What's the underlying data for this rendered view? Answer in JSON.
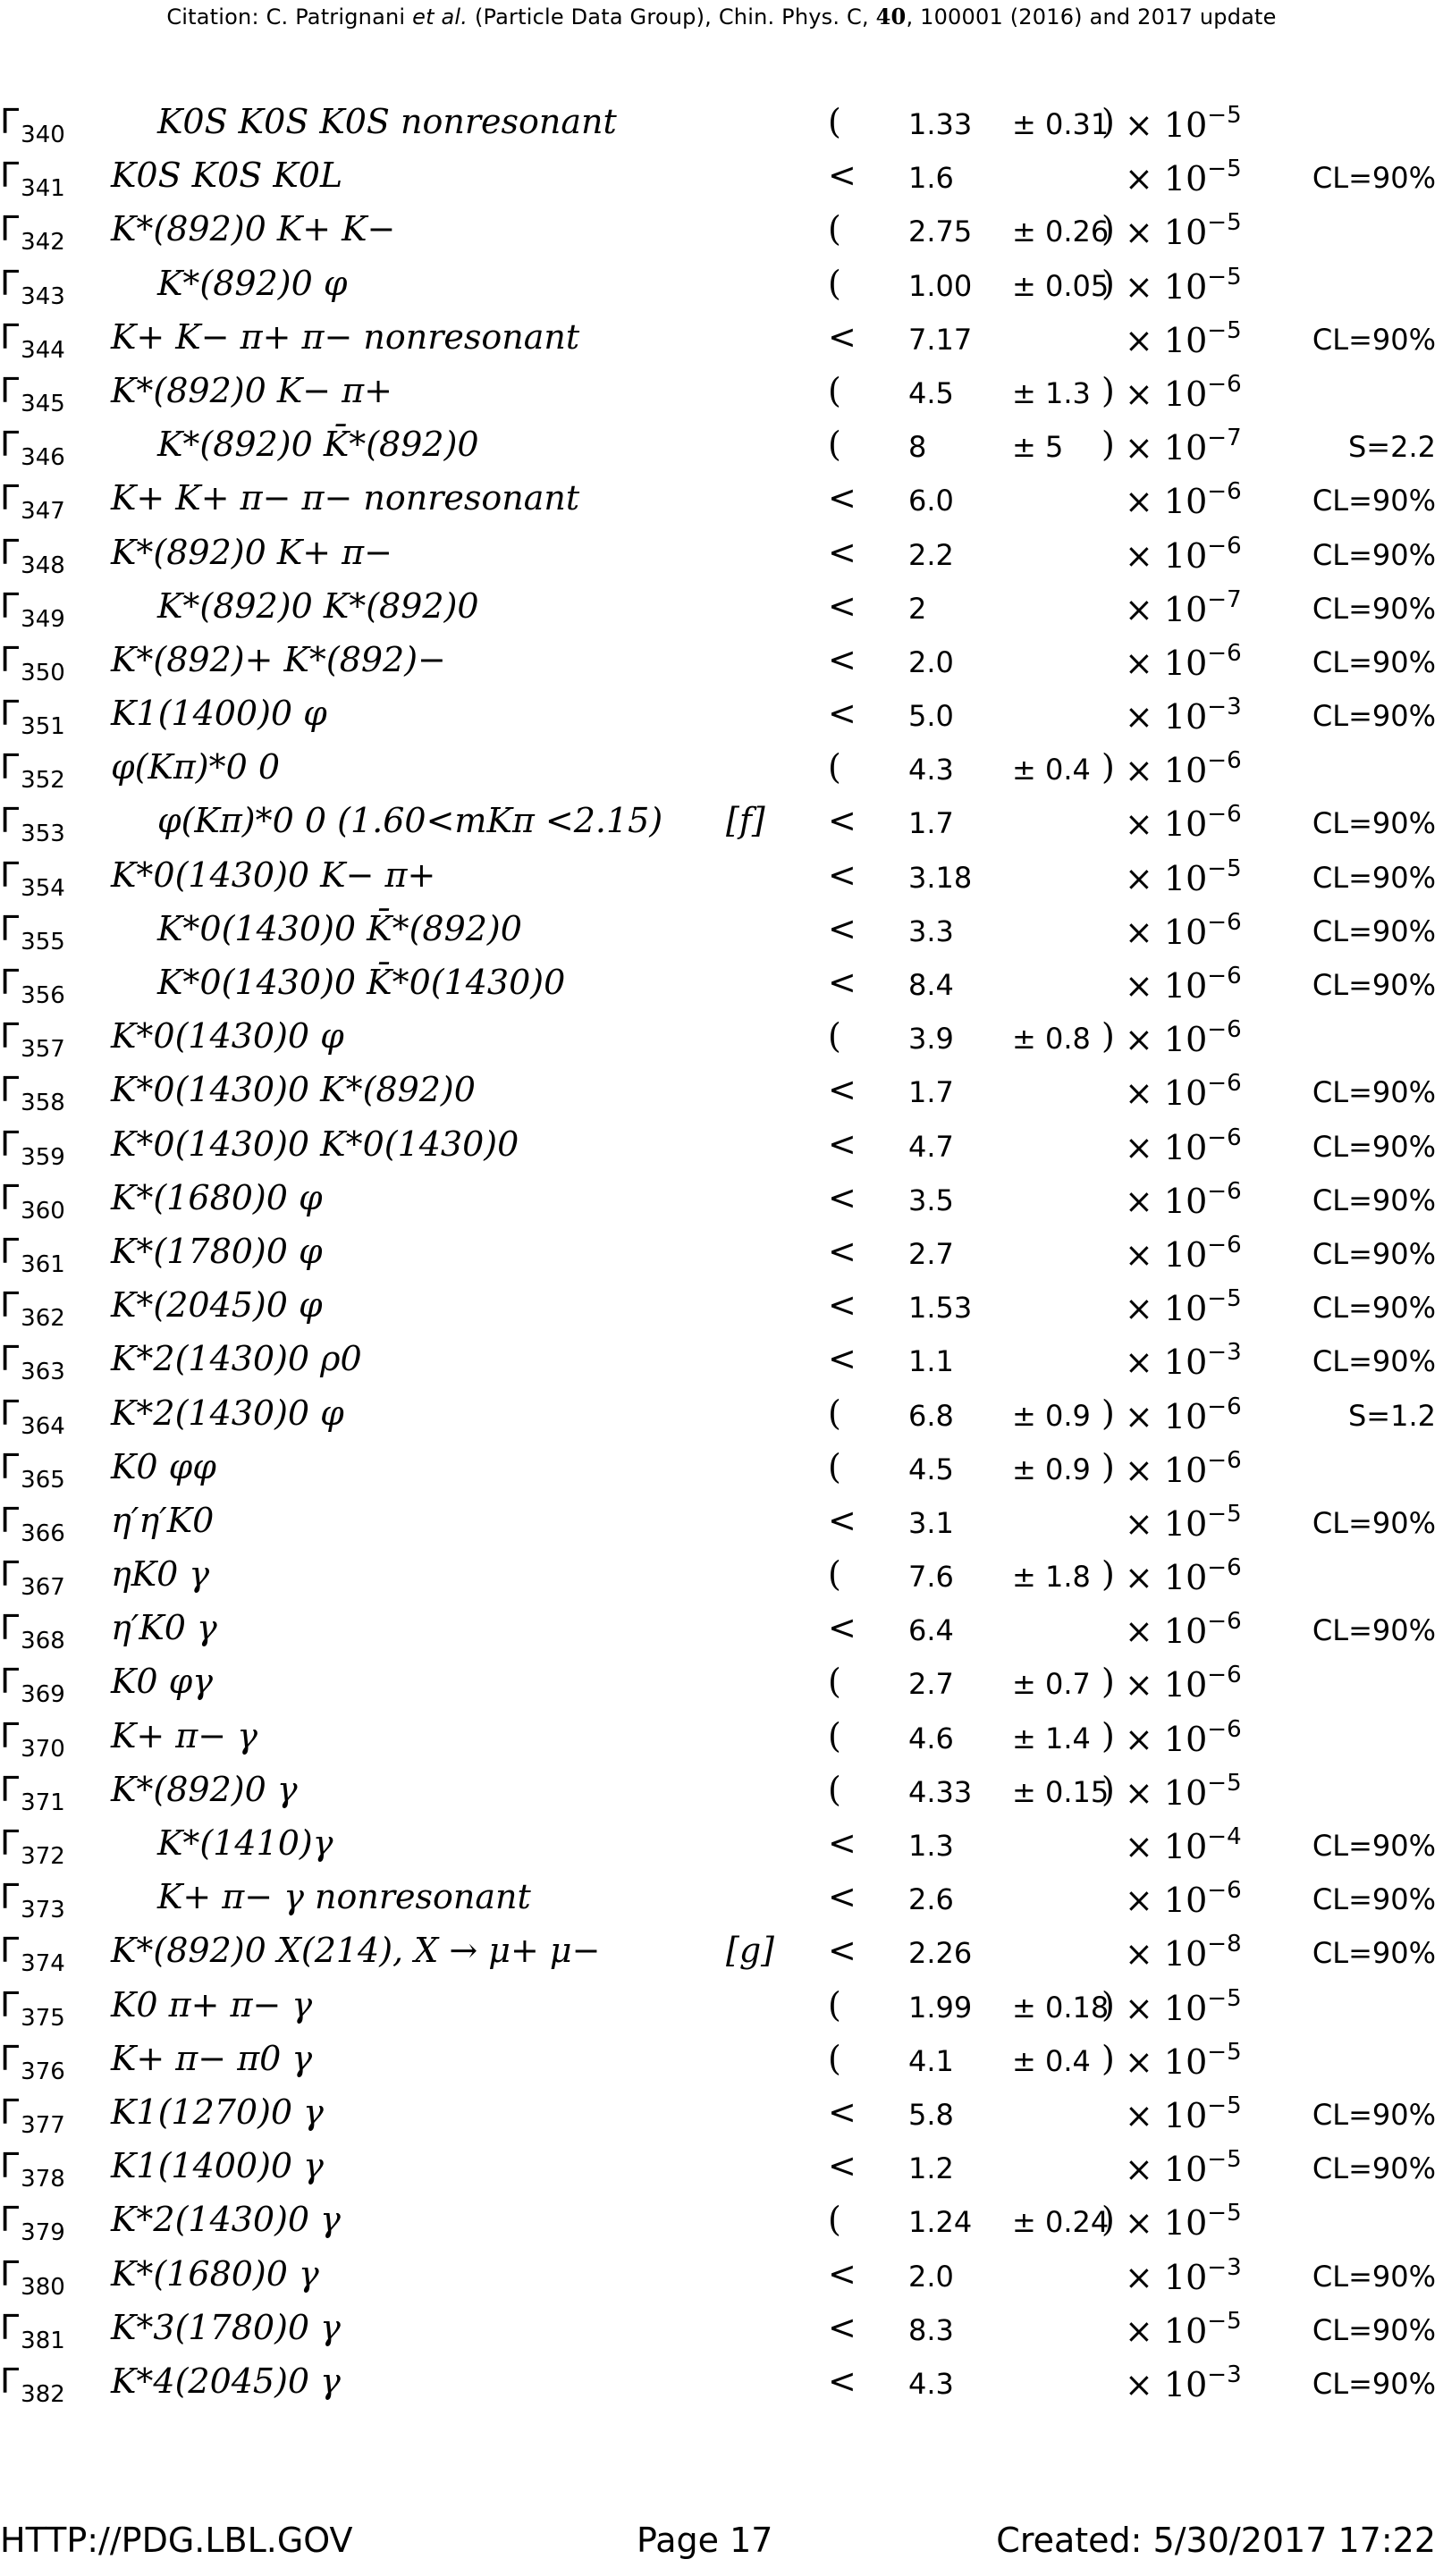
{
  "header": {
    "citation_prefix": "Citation: C. Patrignani ",
    "citation_etal": "et al.",
    "citation_mid": " (Particle Data Group), Chin. Phys. C, ",
    "citation_vol": "40",
    "citation_suffix": ", 100001 (2016) and 2017 update"
  },
  "rows": [
    {
      "gamma": "340",
      "mode": "K0S K0S K0S nonresonant",
      "indent": true,
      "rel": "(",
      "value": "1.33",
      "error": "± 0.31",
      "close": ")",
      "exponent": "−5",
      "extra": ""
    },
    {
      "gamma": "341",
      "mode": "K0S K0S K0L",
      "indent": false,
      "rel": "<",
      "value": "1.6",
      "error": "",
      "close": "",
      "exponent": "−5",
      "extra": "CL=90%"
    },
    {
      "gamma": "342",
      "mode": "K*(892)0 K+ K−",
      "indent": false,
      "rel": "(",
      "value": "2.75",
      "error": "± 0.26",
      "close": ")",
      "exponent": "−5",
      "extra": ""
    },
    {
      "gamma": "343",
      "mode": "K*(892)0 φ",
      "indent": true,
      "rel": "(",
      "value": "1.00",
      "error": "± 0.05",
      "close": ")",
      "exponent": "−5",
      "extra": ""
    },
    {
      "gamma": "344",
      "mode": "K+ K− π+ π− nonresonant",
      "indent": false,
      "rel": "<",
      "value": "7.17",
      "error": "",
      "close": "",
      "exponent": "−5",
      "extra": "CL=90%"
    },
    {
      "gamma": "345",
      "mode": "K*(892)0 K− π+",
      "indent": false,
      "rel": "(",
      "value": "4.5",
      "error": "± 1.3",
      "close": ")",
      "exponent": "−6",
      "extra": ""
    },
    {
      "gamma": "346",
      "mode": "K*(892)0 K̄*(892)0",
      "indent": true,
      "rel": "(",
      "value": "8",
      "error": "± 5",
      "close": ")",
      "exponent": "−7",
      "extra": "S=2.2"
    },
    {
      "gamma": "347",
      "mode": "K+ K+ π− π− nonresonant",
      "indent": false,
      "rel": "<",
      "value": "6.0",
      "error": "",
      "close": "",
      "exponent": "−6",
      "extra": "CL=90%"
    },
    {
      "gamma": "348",
      "mode": "K*(892)0 K+ π−",
      "indent": false,
      "rel": "<",
      "value": "2.2",
      "error": "",
      "close": "",
      "exponent": "−6",
      "extra": "CL=90%"
    },
    {
      "gamma": "349",
      "mode": "K*(892)0 K*(892)0",
      "indent": true,
      "rel": "<",
      "value": "2",
      "error": "",
      "close": "",
      "exponent": "−7",
      "extra": "CL=90%"
    },
    {
      "gamma": "350",
      "mode": "K*(892)+ K*(892)−",
      "indent": false,
      "rel": "<",
      "value": "2.0",
      "error": "",
      "close": "",
      "exponent": "−6",
      "extra": "CL=90%"
    },
    {
      "gamma": "351",
      "mode": "K1(1400)0 φ",
      "indent": false,
      "rel": "<",
      "value": "5.0",
      "error": "",
      "close": "",
      "exponent": "−3",
      "extra": "CL=90%"
    },
    {
      "gamma": "352",
      "mode": "φ(Kπ)*0 0",
      "indent": false,
      "rel": "(",
      "value": "4.3",
      "error": "± 0.4",
      "close": ")",
      "exponent": "−6",
      "extra": ""
    },
    {
      "gamma": "353",
      "mode": "φ(Kπ)*0 0 (1.60<mKπ <2.15)",
      "indent": true,
      "note": "[f]",
      "rel": "<",
      "value": "1.7",
      "error": "",
      "close": "",
      "exponent": "−6",
      "extra": "CL=90%"
    },
    {
      "gamma": "354",
      "mode": "K*0(1430)0 K− π+",
      "indent": false,
      "rel": "<",
      "value": "3.18",
      "error": "",
      "close": "",
      "exponent": "−5",
      "extra": "CL=90%"
    },
    {
      "gamma": "355",
      "mode": "K*0(1430)0 K̄*(892)0",
      "indent": true,
      "rel": "<",
      "value": "3.3",
      "error": "",
      "close": "",
      "exponent": "−6",
      "extra": "CL=90%"
    },
    {
      "gamma": "356",
      "mode": "K*0(1430)0 K̄*0(1430)0",
      "indent": true,
      "rel": "<",
      "value": "8.4",
      "error": "",
      "close": "",
      "exponent": "−6",
      "extra": "CL=90%"
    },
    {
      "gamma": "357",
      "mode": "K*0(1430)0 φ",
      "indent": false,
      "rel": "(",
      "value": "3.9",
      "error": "± 0.8",
      "close": ")",
      "exponent": "−6",
      "extra": ""
    },
    {
      "gamma": "358",
      "mode": "K*0(1430)0 K*(892)0",
      "indent": false,
      "rel": "<",
      "value": "1.7",
      "error": "",
      "close": "",
      "exponent": "−6",
      "extra": "CL=90%"
    },
    {
      "gamma": "359",
      "mode": "K*0(1430)0 K*0(1430)0",
      "indent": false,
      "rel": "<",
      "value": "4.7",
      "error": "",
      "close": "",
      "exponent": "−6",
      "extra": "CL=90%"
    },
    {
      "gamma": "360",
      "mode": "K*(1680)0 φ",
      "indent": false,
      "rel": "<",
      "value": "3.5",
      "error": "",
      "close": "",
      "exponent": "−6",
      "extra": "CL=90%"
    },
    {
      "gamma": "361",
      "mode": "K*(1780)0 φ",
      "indent": false,
      "rel": "<",
      "value": "2.7",
      "error": "",
      "close": "",
      "exponent": "−6",
      "extra": "CL=90%"
    },
    {
      "gamma": "362",
      "mode": "K*(2045)0 φ",
      "indent": false,
      "rel": "<",
      "value": "1.53",
      "error": "",
      "close": "",
      "exponent": "−5",
      "extra": "CL=90%"
    },
    {
      "gamma": "363",
      "mode": "K*2(1430)0 ρ0",
      "indent": false,
      "rel": "<",
      "value": "1.1",
      "error": "",
      "close": "",
      "exponent": "−3",
      "extra": "CL=90%"
    },
    {
      "gamma": "364",
      "mode": "K*2(1430)0 φ",
      "indent": false,
      "rel": "(",
      "value": "6.8",
      "error": "± 0.9",
      "close": ")",
      "exponent": "−6",
      "extra": "S=1.2"
    },
    {
      "gamma": "365",
      "mode": "K0 φφ",
      "indent": false,
      "rel": "(",
      "value": "4.5",
      "error": "± 0.9",
      "close": ")",
      "exponent": "−6",
      "extra": ""
    },
    {
      "gamma": "366",
      "mode": "η′η′K0",
      "indent": false,
      "rel": "<",
      "value": "3.1",
      "error": "",
      "close": "",
      "exponent": "−5",
      "extra": "CL=90%"
    },
    {
      "gamma": "367",
      "mode": "ηK0 γ",
      "indent": false,
      "rel": "(",
      "value": "7.6",
      "error": "± 1.8",
      "close": ")",
      "exponent": "−6",
      "extra": ""
    },
    {
      "gamma": "368",
      "mode": "η′K0 γ",
      "indent": false,
      "rel": "<",
      "value": "6.4",
      "error": "",
      "close": "",
      "exponent": "−6",
      "extra": "CL=90%"
    },
    {
      "gamma": "369",
      "mode": "K0 φγ",
      "indent": false,
      "rel": "(",
      "value": "2.7",
      "error": "± 0.7",
      "close": ")",
      "exponent": "−6",
      "extra": ""
    },
    {
      "gamma": "370",
      "mode": "K+ π− γ",
      "indent": false,
      "rel": "(",
      "value": "4.6",
      "error": "± 1.4",
      "close": ")",
      "exponent": "−6",
      "extra": ""
    },
    {
      "gamma": "371",
      "mode": "K*(892)0 γ",
      "indent": false,
      "rel": "(",
      "value": "4.33",
      "error": "± 0.15",
      "close": ")",
      "exponent": "−5",
      "extra": ""
    },
    {
      "gamma": "372",
      "mode": "K*(1410)γ",
      "indent": true,
      "rel": "<",
      "value": "1.3",
      "error": "",
      "close": "",
      "exponent": "−4",
      "extra": "CL=90%"
    },
    {
      "gamma": "373",
      "mode": "K+ π− γ nonresonant",
      "indent": true,
      "rel": "<",
      "value": "2.6",
      "error": "",
      "close": "",
      "exponent": "−6",
      "extra": "CL=90%"
    },
    {
      "gamma": "374",
      "mode": "K*(892)0 X(214), X → μ+ μ−",
      "indent": false,
      "note": "[g]",
      "rel": "<",
      "value": "2.26",
      "error": "",
      "close": "",
      "exponent": "−8",
      "extra": "CL=90%"
    },
    {
      "gamma": "375",
      "mode": "K0 π+ π− γ",
      "indent": false,
      "rel": "(",
      "value": "1.99",
      "error": "± 0.18",
      "close": ")",
      "exponent": "−5",
      "extra": ""
    },
    {
      "gamma": "376",
      "mode": "K+ π− π0 γ",
      "indent": false,
      "rel": "(",
      "value": "4.1",
      "error": "± 0.4",
      "close": ")",
      "exponent": "−5",
      "extra": ""
    },
    {
      "gamma": "377",
      "mode": "K1(1270)0 γ",
      "indent": false,
      "rel": "<",
      "value": "5.8",
      "error": "",
      "close": "",
      "exponent": "−5",
      "extra": "CL=90%"
    },
    {
      "gamma": "378",
      "mode": "K1(1400)0 γ",
      "indent": false,
      "rel": "<",
      "value": "1.2",
      "error": "",
      "close": "",
      "exponent": "−5",
      "extra": "CL=90%"
    },
    {
      "gamma": "379",
      "mode": "K*2(1430)0 γ",
      "indent": false,
      "rel": "(",
      "value": "1.24",
      "error": "± 0.24",
      "close": ")",
      "exponent": "−5",
      "extra": ""
    },
    {
      "gamma": "380",
      "mode": "K*(1680)0 γ",
      "indent": false,
      "rel": "<",
      "value": "2.0",
      "error": "",
      "close": "",
      "exponent": "−3",
      "extra": "CL=90%"
    },
    {
      "gamma": "381",
      "mode": "K*3(1780)0 γ",
      "indent": false,
      "rel": "<",
      "value": "8.3",
      "error": "",
      "close": "",
      "exponent": "−5",
      "extra": "CL=90%"
    },
    {
      "gamma": "382",
      "mode": "K*4(2045)0 γ",
      "indent": false,
      "rel": "<",
      "value": "4.3",
      "error": "",
      "close": "",
      "exponent": "−3",
      "extra": "CL=90%"
    }
  ],
  "footer": {
    "url": "HTTP://PDG.LBL.GOV",
    "page": "Page 17",
    "created": "Created: 5/30/2017 17:22"
  }
}
